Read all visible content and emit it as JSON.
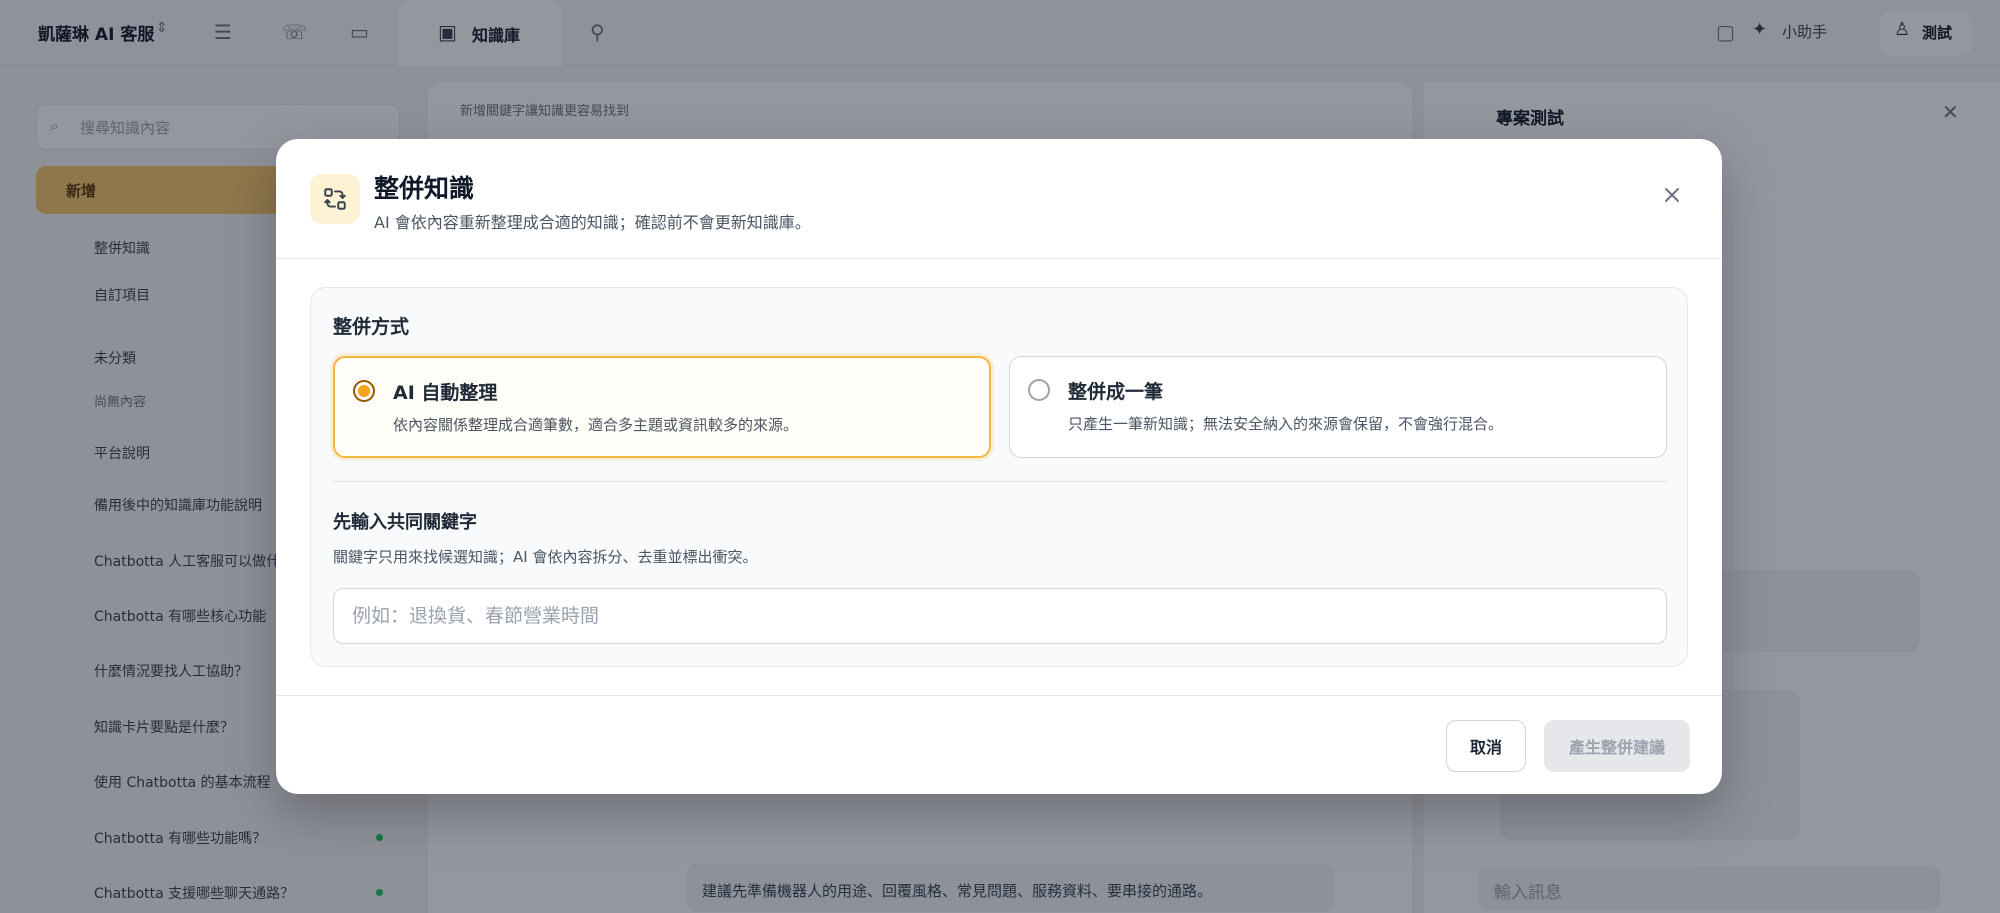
{
  "app": {
    "brand": "凱薩琳 AI 客服",
    "active_tab": "知識庫",
    "helper": "小助手",
    "user": "測試"
  },
  "sidebar": {
    "search_placeholder": "搜尋知識內容",
    "new_label": "新增",
    "items": [
      {
        "label": "整併知識"
      },
      {
        "label": "自訂項目"
      },
      {
        "label": "未分類"
      },
      {
        "label": "尚無內容"
      },
      {
        "label": "平台說明"
      },
      {
        "label": "備用後中的知識庫功能說明"
      },
      {
        "label": "Chatbotta 人工客服可以做什麼"
      },
      {
        "label": "Chatbotta 有哪些核心功能"
      },
      {
        "label": "什麼情況要找人工協助？"
      },
      {
        "label": "知識卡片要點是什麼？"
      },
      {
        "label": "使用 Chatbotta 的基本流程"
      },
      {
        "label": "Chatbotta 有哪些功能嗎？"
      },
      {
        "label": "Chatbotta 支援哪些聊天通路？"
      }
    ]
  },
  "main": {
    "hint": "新增關鍵字讓知識更容易找到",
    "bottom_text": "建議先準備機器人的用途、回覆風格、常見問題、服務資料、要串接的通路。"
  },
  "chat": {
    "title": "專案測試",
    "input_placeholder": "輸入訊息"
  },
  "modal": {
    "title": "整併知識",
    "subtitle": "AI 會依內容重新整理成合適的知識；確認前不會更新知識庫。",
    "section_title": "整併方式",
    "options": [
      {
        "title": "AI 自動整理",
        "desc": "依內容關係整理成合適筆數，適合多主題或資訊較多的來源。",
        "selected": true
      },
      {
        "title": "整併成一筆",
        "desc": "只產生一筆新知識；無法安全納入的來源會保留，不會強行混合。",
        "selected": false
      }
    ],
    "keyword_title": "先輸入共同關鍵字",
    "keyword_desc": "關鍵字只用來找候選知識；AI 會依內容拆分、去重並標出衝突。",
    "keyword_placeholder": "例如：退換貨、春節營業時間",
    "keyword_value": "",
    "cancel_label": "取消",
    "generate_label": "產生整併建議",
    "accent_color": "#f4b73c"
  }
}
